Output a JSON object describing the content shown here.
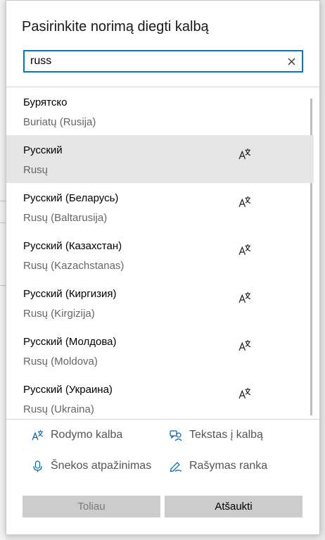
{
  "dialog": {
    "title": "Pasirinkite norimą diegti kalbą"
  },
  "search": {
    "value": "russ",
    "clear_icon": "close-icon"
  },
  "languages": [
    {
      "native": "Бурятско",
      "localized": "Buriatų (Rusija)",
      "display_language": false,
      "selected": false
    },
    {
      "native": "Русский",
      "localized": "Rusų",
      "display_language": true,
      "selected": true
    },
    {
      "native": "Русский (Беларусь)",
      "localized": "Rusų (Baltarusija)",
      "display_language": true,
      "selected": false
    },
    {
      "native": "Русский (Казахстан)",
      "localized": "Rusų (Kazachstanas)",
      "display_language": true,
      "selected": false
    },
    {
      "native": "Русский (Киргизия)",
      "localized": "Rusų (Kirgizija)",
      "display_language": true,
      "selected": false
    },
    {
      "native": "Русский (Молдова)",
      "localized": "Rusų (Moldova)",
      "display_language": true,
      "selected": false
    },
    {
      "native": "Русский (Украина)",
      "localized": "Rusų (Ukraina)",
      "display_language": true,
      "selected": false
    }
  ],
  "legend": {
    "display_language": {
      "label": "Rodymo kalba",
      "icon": "display-language-icon"
    },
    "text_to_speech": {
      "label": "Tekstas į kalbą",
      "icon": "text-to-speech-icon"
    },
    "speech_recognition": {
      "label": "Šnekos atpažinimas",
      "icon": "microphone-icon"
    },
    "handwriting": {
      "label": "Rašymas ranka",
      "icon": "handwriting-icon"
    }
  },
  "buttons": {
    "next": "Toliau",
    "cancel": "Atšaukti"
  },
  "colors": {
    "accent": "#0078d7",
    "icon": "#0063b1",
    "selected_row": "#e6e6e6",
    "button": "#cccccc"
  }
}
